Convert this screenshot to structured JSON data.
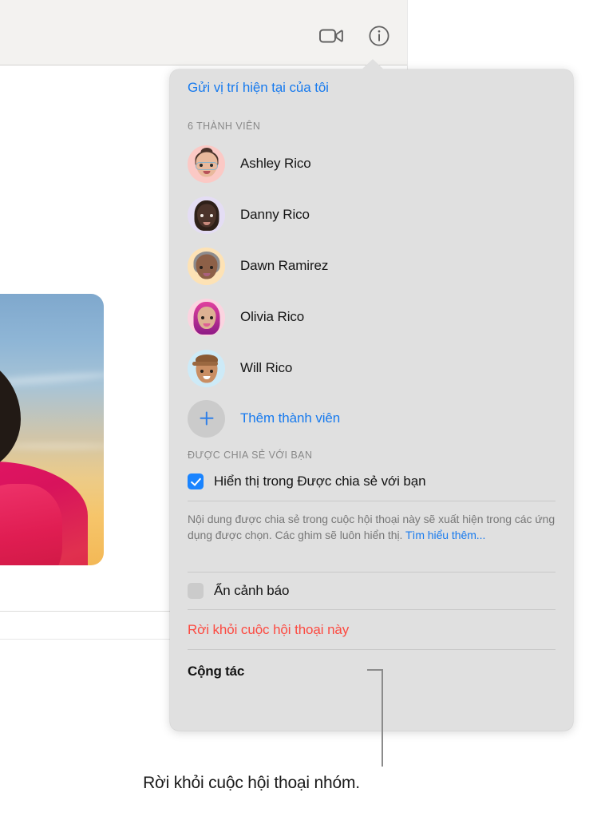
{
  "window": {
    "toolbar": {
      "facetime_icon": "video-camera-icon",
      "info_icon": "info-circle-icon"
    },
    "conversation_photo_alt": "photo-attachment"
  },
  "popover": {
    "send_location_link": "Gửi vị trí hiện tại của tôi",
    "members_header": "6 THÀNH VIÊN",
    "members": [
      {
        "name": "Ashley Rico",
        "avatar_bg": "#fbc9c5",
        "hair": "#4a332a",
        "skin": "#e9b99c"
      },
      {
        "name": "Danny Rico",
        "avatar_bg": "#e4ddf4",
        "hair": "#2e2019",
        "skin": "#4b332a"
      },
      {
        "name": "Dawn Ramirez",
        "avatar_bg": "#fde2b5",
        "hair": "#8d8c8e",
        "skin": "#8d6047"
      },
      {
        "name": "Olivia Rico",
        "avatar_bg": "#fbd4e0",
        "hair": "#b7268c",
        "skin": "#ddb193"
      },
      {
        "name": "Will Rico",
        "avatar_bg": "#cdeaf7",
        "hair": "#8a5a35",
        "skin": "#c98e63"
      }
    ],
    "add_member_label": "Thêm thành viên",
    "add_member_icon": "plus-icon",
    "shared_with_you_header": "ĐƯỢC CHIA SẺ VỚI BẠN",
    "show_in_shared_label": "Hiển thị trong Được chia sẻ với bạn",
    "show_in_shared_checked": true,
    "description": "Nội dung được chia sẻ trong cuộc hội thoại này sẽ xuất hiện trong các ứng dụng được chọn. Các ghim sẽ luôn hiển thị.",
    "learn_more_label": "Tìm hiểu thêm...",
    "hide_alerts_label": "Ẩn cảnh báo",
    "hide_alerts_checked": false,
    "leave_conversation_label": "Rời khỏi cuộc hội thoại này",
    "collaborate_label": "Cộng tác"
  },
  "callout": {
    "text": "Rời khỏi cuộc hội thoại nhóm."
  },
  "colors": {
    "accent_blue": "#177aee",
    "destructive_red": "#fc4a41",
    "checkbox_blue": "#1a84ff",
    "popover_bg": "#e0e0e0",
    "toolbar_bg": "#f3f2f0"
  }
}
